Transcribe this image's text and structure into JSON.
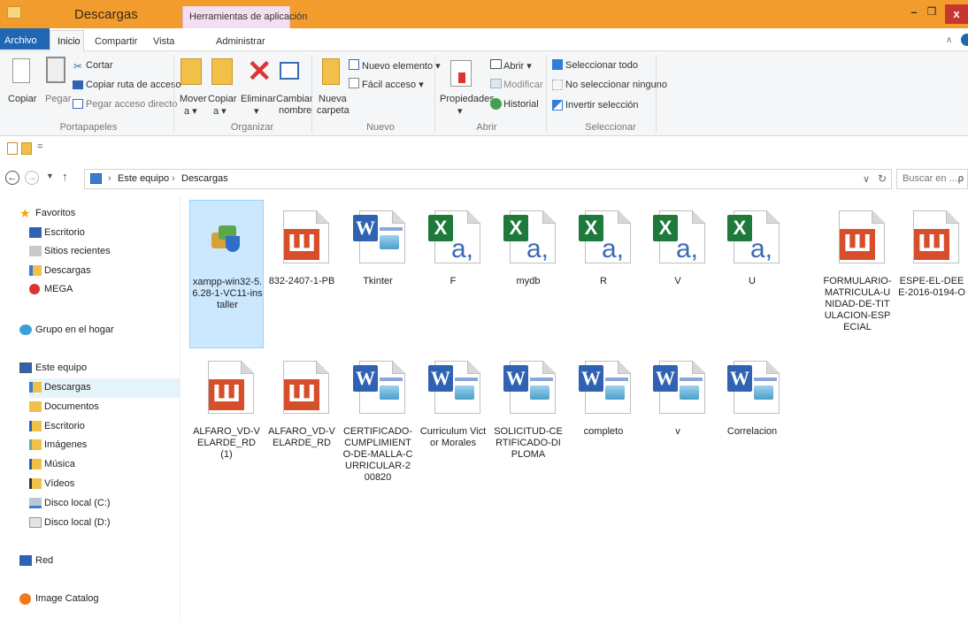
{
  "title": {
    "window_title": "Descargas",
    "tools_tab": "Herramientas de aplicación",
    "min": "–",
    "max": "❐",
    "close": "x"
  },
  "tabs": [
    "Archivo",
    "Inicio",
    "Compartir",
    "Vista",
    "Administrar"
  ],
  "ribbon": {
    "portapapeles": {
      "copiar": "Copiar",
      "pegar": "Pegar",
      "cortar": "Cortar",
      "copiar_ruta": "Copiar ruta de acceso",
      "pegar_acceso": "Pegar acceso directo",
      "group": "Portapapeles"
    },
    "organizar": {
      "mover": "Mover",
      "mover2": "a ▾",
      "copiar": "Copiar",
      "copiar2": "a ▾",
      "eliminar": "Eliminar",
      "eliminar2": "▾",
      "cambiar": "Cambiar",
      "cambiar2": "nombre",
      "group": "Organizar"
    },
    "nuevo": {
      "nueva": "Nueva",
      "carpeta": "carpeta",
      "nuevo_elemento": "Nuevo elemento ▾",
      "facil_acceso": "Fácil acceso ▾",
      "group": "Nuevo"
    },
    "abrir": {
      "propiedades": "Propiedades",
      "propiedades2": "▾",
      "abrir": "Abrir ▾",
      "modificar": "Modificar",
      "historial": "Historial",
      "group": "Abrir"
    },
    "seleccionar": {
      "todo": "Seleccionar todo",
      "ninguno": "No seleccionar ninguno",
      "invertir": "Invertir selección",
      "group": "Seleccionar"
    }
  },
  "qat": {
    "dropdown": "="
  },
  "address": {
    "crumb1": "Este equipo",
    "crumb2": "Descargas",
    "sep": "›",
    "search_placeholder": "Buscar en ...",
    "search_icon": "ρ",
    "refresh": "↻",
    "dropdown": "∨"
  },
  "nav": {
    "favoritos": "Favoritos",
    "escritorio": "Escritorio",
    "sitios": "Sitios recientes",
    "descargas": "Descargas",
    "mega": "MEGA",
    "grupo": "Grupo en el hogar",
    "este_equipo": "Este equipo",
    "descargas2": "Descargas",
    "documentos": "Documentos",
    "escritorio2": "Escritorio",
    "imagenes": "Imágenes",
    "musica": "Música",
    "videos": "Vídeos",
    "disco_c": "Disco local (C:)",
    "disco_d": "Disco local (D:)",
    "red": "Red",
    "catalog": "Image Catalog"
  },
  "files": [
    {
      "name": "xampp-win32-5.6.28-1-VC11-installer",
      "icon": "installer-icon"
    },
    {
      "name": "832-2407-1-PB",
      "icon": "pdf-icon"
    },
    {
      "name": "Tkinter",
      "icon": "word-icon"
    },
    {
      "name": "F",
      "icon": "excel-icon"
    },
    {
      "name": "mydb",
      "icon": "excel-icon"
    },
    {
      "name": "R",
      "icon": "excel-icon"
    },
    {
      "name": "V",
      "icon": "excel-icon"
    },
    {
      "name": "U",
      "icon": "excel-icon"
    },
    {
      "name": "FORMULARIO-MATRICULA-UNIDAD-DE-TITULACION-ESPECIAL",
      "icon": "pdf-icon"
    },
    {
      "name": "ESPE-EL-DEEE-2016-0194-O",
      "icon": "pdf-icon"
    },
    {
      "name": "ALFARO_VD-VELARDE_RD (1)",
      "icon": "pdf-icon"
    },
    {
      "name": "ALFARO_VD-VELARDE_RD",
      "icon": "pdf-icon"
    },
    {
      "name": "CERTIFICADO-CUMPLIMIENTO-DE-MALLA-CURRICULAR-200820",
      "icon": "word-icon"
    },
    {
      "name": "Curriculum Victor Morales",
      "icon": "word-old-icon"
    },
    {
      "name": "SOLICITUD-CERTIFICADO-DIPLOMA",
      "icon": "word-old-icon"
    },
    {
      "name": "completo",
      "icon": "word-icon"
    },
    {
      "name": "v",
      "icon": "word-icon"
    },
    {
      "name": "Correlacion",
      "icon": "word-old-icon"
    }
  ]
}
